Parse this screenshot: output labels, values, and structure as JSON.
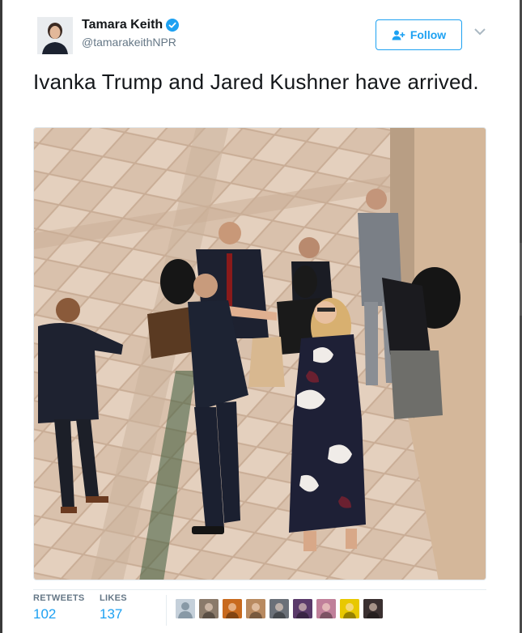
{
  "author": {
    "name": "Tamara Keith",
    "handle": "@tamarakeithNPR",
    "verified": true
  },
  "follow_button": {
    "label": "Follow",
    "icon": "add-user-icon"
  },
  "menu_icon": "chevron-down-icon",
  "tweet": {
    "text": "Ivanka Trump and Jared Kushner have arrived."
  },
  "media": {
    "type": "photo"
  },
  "stats": {
    "retweets_label": "RETWEETS",
    "retweets": "102",
    "likes_label": "LIKES",
    "likes": "137"
  },
  "likers": [
    {
      "color": "#9aa8b5",
      "kind": "default-avatar"
    },
    {
      "color": "#8a7a6a"
    },
    {
      "color": "#c86a1e"
    },
    {
      "color": "#b88a60"
    },
    {
      "color": "#6a7078"
    },
    {
      "color": "#5a3a6a"
    },
    {
      "color": "#c0809a"
    },
    {
      "color": "#e8c800"
    },
    {
      "color": "#3a3030"
    }
  ],
  "colors": {
    "accent": "#1da1f2",
    "text": "#14171a",
    "secondary": "#657786"
  }
}
